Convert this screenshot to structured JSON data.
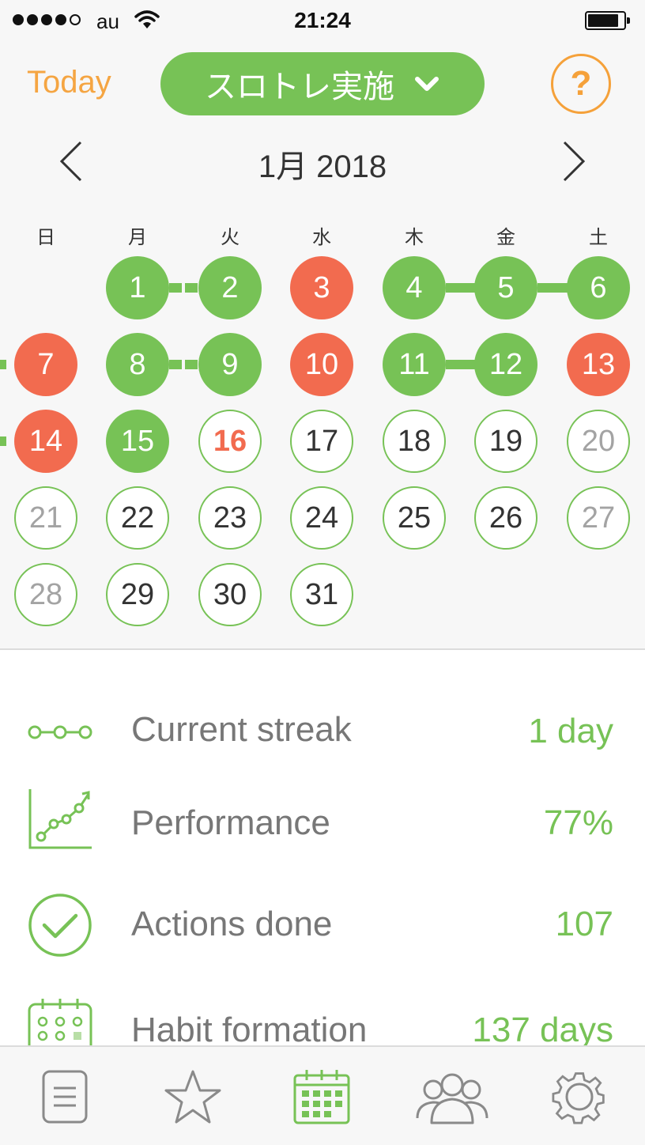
{
  "status_bar": {
    "carrier": "au",
    "time": "21:24"
  },
  "header": {
    "today_label": "Today",
    "habit_name": "スロトレ実施",
    "help_label": "?"
  },
  "calendar": {
    "month_label": "1月 2018",
    "weekdays": [
      "日",
      "月",
      "火",
      "水",
      "木",
      "金",
      "土"
    ],
    "weeks": [
      [
        null,
        "1",
        "2",
        "3",
        "4",
        "5",
        "6"
      ],
      [
        "7",
        "8",
        "9",
        "10",
        "11",
        "12",
        "13"
      ],
      [
        "14",
        "15",
        "16",
        "17",
        "18",
        "19",
        "20"
      ],
      [
        "21",
        "22",
        "23",
        "24",
        "25",
        "26",
        "27"
      ],
      [
        "28",
        "29",
        "30",
        "31",
        null,
        null,
        null
      ]
    ],
    "status": {
      "done": [
        1,
        2,
        4,
        5,
        6,
        8,
        9,
        11,
        12,
        15
      ],
      "missed": [
        3,
        7,
        10,
        13,
        14
      ],
      "today": 16
    },
    "colors": {
      "done": "#77c256",
      "missed": "#f26b4f",
      "accent_orange": "#f5a542"
    }
  },
  "stats": [
    {
      "icon": "streak-icon",
      "label": "Current streak",
      "value": "1 day"
    },
    {
      "icon": "performance-chart-icon",
      "label": "Performance",
      "value": "77%"
    },
    {
      "icon": "checkmark-circle-icon",
      "label": "Actions done",
      "value": "107"
    },
    {
      "icon": "calendar-grid-icon",
      "label": "Habit formation",
      "value": "137 days"
    }
  ],
  "tabbar": {
    "items": [
      {
        "icon": "notes-icon",
        "active": false
      },
      {
        "icon": "star-icon",
        "active": false
      },
      {
        "icon": "calendar-icon",
        "active": true
      },
      {
        "icon": "people-icon",
        "active": false
      },
      {
        "icon": "gear-icon",
        "active": false
      }
    ]
  }
}
